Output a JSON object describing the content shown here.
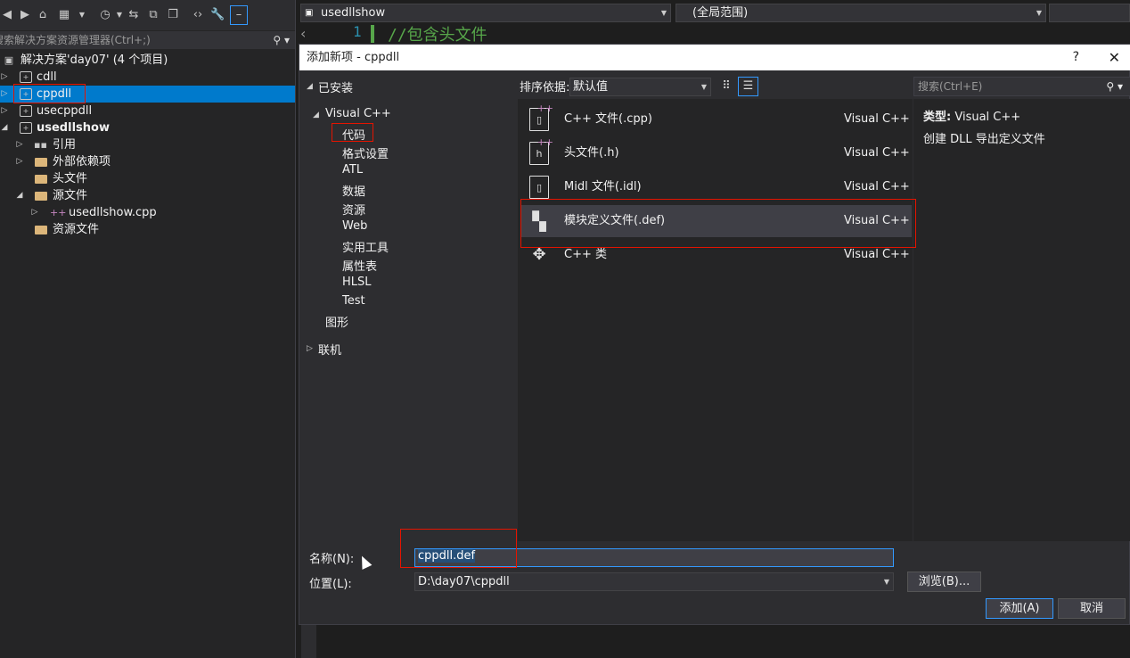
{
  "solution_explorer": {
    "search_placeholder": "搜索解决方案资源管理器(Ctrl+;)",
    "items": [
      {
        "label": "解决方案'day07' (4 个项目)"
      },
      {
        "label": "cdll"
      },
      {
        "label": "cppdll"
      },
      {
        "label": "usecppdll"
      },
      {
        "label": "usedllshow"
      },
      {
        "label": "引用"
      },
      {
        "label": "外部依赖项"
      },
      {
        "label": "头文件"
      },
      {
        "label": "源文件"
      },
      {
        "label": "usedllshow.cpp"
      },
      {
        "label": "资源文件"
      }
    ]
  },
  "editor": {
    "file_dropdown": "usedllshow",
    "scope_dropdown": "(全局范围)",
    "line_number": "1",
    "code_line": "//包含头文件"
  },
  "dialog": {
    "title": "添加新项 - cppdll",
    "help": "?",
    "close": "✕",
    "installed": "已安装",
    "visual_cpp": "Visual C++",
    "categories": [
      "代码",
      "格式设置",
      "ATL",
      "数据",
      "资源",
      "Web",
      "实用工具",
      "属性表",
      "HLSL",
      "Test"
    ],
    "graphics": "图形",
    "online": "联机",
    "sort_label": "排序依据:",
    "sort_value": "默认值",
    "search_placeholder": "搜索(Ctrl+E)",
    "templates": [
      {
        "name": "C++ 文件(.cpp)",
        "lang": "Visual C++",
        "icon": "cpp-file-icon"
      },
      {
        "name": "头文件(.h)",
        "lang": "Visual C++",
        "icon": "header-file-icon"
      },
      {
        "name": "Midl 文件(.idl)",
        "lang": "Visual C++",
        "icon": "idl-file-icon"
      },
      {
        "name": "模块定义文件(.def)",
        "lang": "Visual C++",
        "icon": "def-file-icon"
      },
      {
        "name": "C++ 类",
        "lang": "Visual C++",
        "icon": "cpp-class-icon"
      }
    ],
    "type_label": "类型:",
    "type_value": "Visual C++",
    "description": "创建 DLL 导出定义文件",
    "name_label": "名称(N):",
    "name_value": "cppdll.def",
    "location_label": "位置(L):",
    "location_value": "D:\\day07\\cppdll",
    "browse_button": "浏览(B)...",
    "add_button": "添加(A)",
    "cancel_button": "取消"
  },
  "colors": {
    "accent": "#007acc",
    "highlight_box": "#e51400",
    "comment": "#57a64a"
  }
}
